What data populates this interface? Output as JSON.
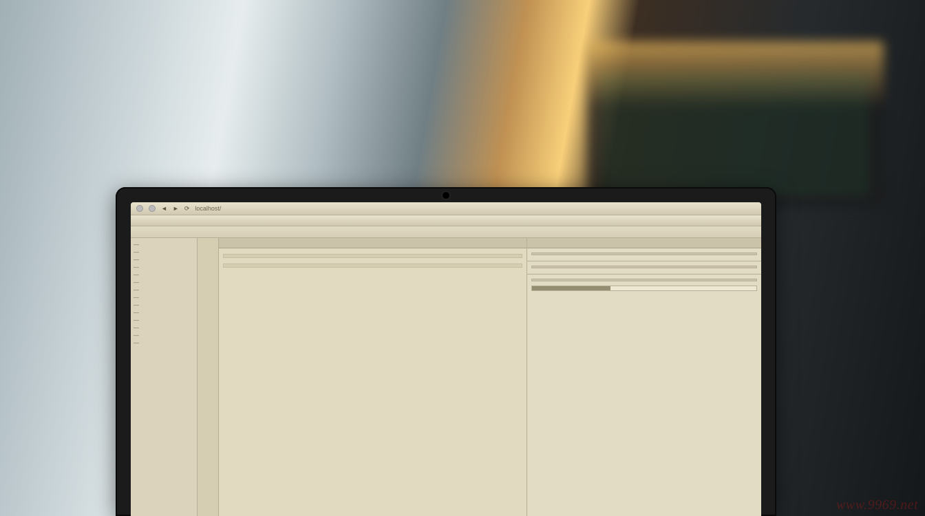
{
  "watermark_text": "www.9969.net",
  "titlebar": {
    "url_hint": "localhost/",
    "right_text": ""
  },
  "menubar": {
    "left": "",
    "center": "",
    "right": ""
  },
  "sidebar": {
    "items": [
      "—",
      "—",
      "—",
      "—",
      "—",
      "—",
      "—",
      "—",
      "—",
      "—",
      "—",
      "—",
      "—",
      "—"
    ]
  },
  "gutter": {
    "marks": [
      "",
      "",
      "",
      "",
      "",
      "",
      "",
      "",
      "",
      "",
      "",
      "",
      "",
      "",
      "",
      "",
      "",
      ""
    ]
  },
  "editor": {
    "tab_label": "",
    "lines": [
      "",
      "",
      "",
      "",
      "",
      "",
      "",
      "",
      "",
      "",
      "",
      "",
      "",
      "",
      "",
      "",
      "",
      ""
    ],
    "highlight_block_1": [
      "",
      ""
    ],
    "block_title": "",
    "block_lines": [
      "",
      "",
      ""
    ],
    "lower_lines": [
      "",
      "",
      "",
      ""
    ]
  },
  "right": {
    "header_lines": [
      "",
      "",
      ""
    ],
    "section1": {
      "title": "",
      "rows": [
        "",
        "",
        ""
      ]
    },
    "section2": {
      "title": "",
      "rows": [
        "",
        ""
      ]
    },
    "section3": {
      "title": "",
      "rows": [
        "",
        ""
      ]
    },
    "progress_pct": 35
  }
}
